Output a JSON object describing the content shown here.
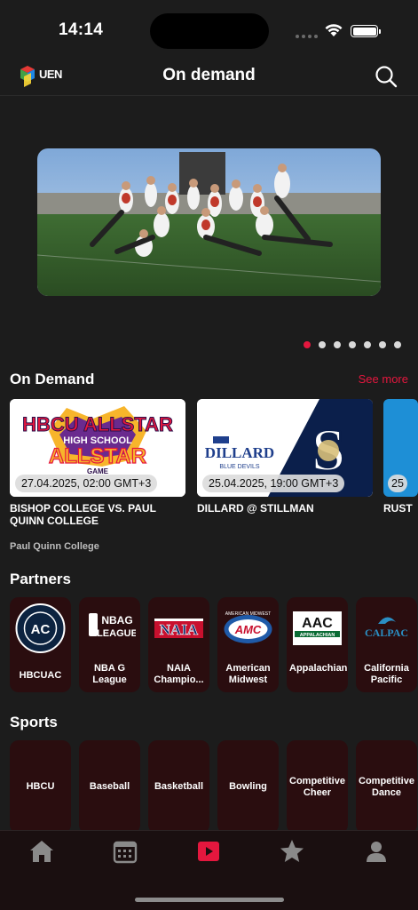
{
  "status": {
    "time": "14:14"
  },
  "header": {
    "title": "On demand",
    "logo_text": "UEN"
  },
  "carousel": {
    "dot_count": 7,
    "active_index": 0
  },
  "on_demand": {
    "title": "On Demand",
    "see_more": "See more",
    "cards": [
      {
        "date": "27.04.2025, 02:00 GMT+3",
        "title": "BISHOP COLLEGE VS. PAUL QUINN COLLEGE",
        "subtitle": "Paul Quinn College",
        "thumb_text": "HBCU ALLSTAR"
      },
      {
        "date": "25.04.2025, 19:00 GMT+3",
        "title": "DILLARD @ STILLMAN",
        "subtitle": "",
        "thumb_text": "DILLARD"
      },
      {
        "date": "25",
        "title": "RUST",
        "subtitle": ""
      }
    ]
  },
  "partners": {
    "title": "Partners",
    "items": [
      {
        "label": "HBCUAC",
        "logo_text": "HBCUAC"
      },
      {
        "label": "NBA G League",
        "logo_text": "NBA G LEAGUE"
      },
      {
        "label": "NAIA Champio...",
        "logo_text": "NAIA"
      },
      {
        "label": "American Midwest",
        "logo_text": "AMC"
      },
      {
        "label": "Appalachian",
        "logo_text": "AAC"
      },
      {
        "label": "California Pacific",
        "logo_text": "CALPAC"
      }
    ]
  },
  "sports": {
    "title": "Sports",
    "items": [
      {
        "label": "HBCU"
      },
      {
        "label": "Baseball"
      },
      {
        "label": "Basketball"
      },
      {
        "label": "Bowling"
      },
      {
        "label": "Competitive Cheer"
      },
      {
        "label": "Competitive Dance"
      }
    ]
  },
  "tabs": [
    {
      "icon": "home-icon",
      "active": false
    },
    {
      "icon": "calendar-icon",
      "active": false
    },
    {
      "icon": "play-icon",
      "active": true
    },
    {
      "icon": "star-icon",
      "active": false
    },
    {
      "icon": "profile-icon",
      "active": false
    }
  ],
  "colors": {
    "accent": "#e4173e",
    "background": "#1c1c1c",
    "tile": "#2a0d0f",
    "tab_inactive": "#8a8a8a"
  }
}
